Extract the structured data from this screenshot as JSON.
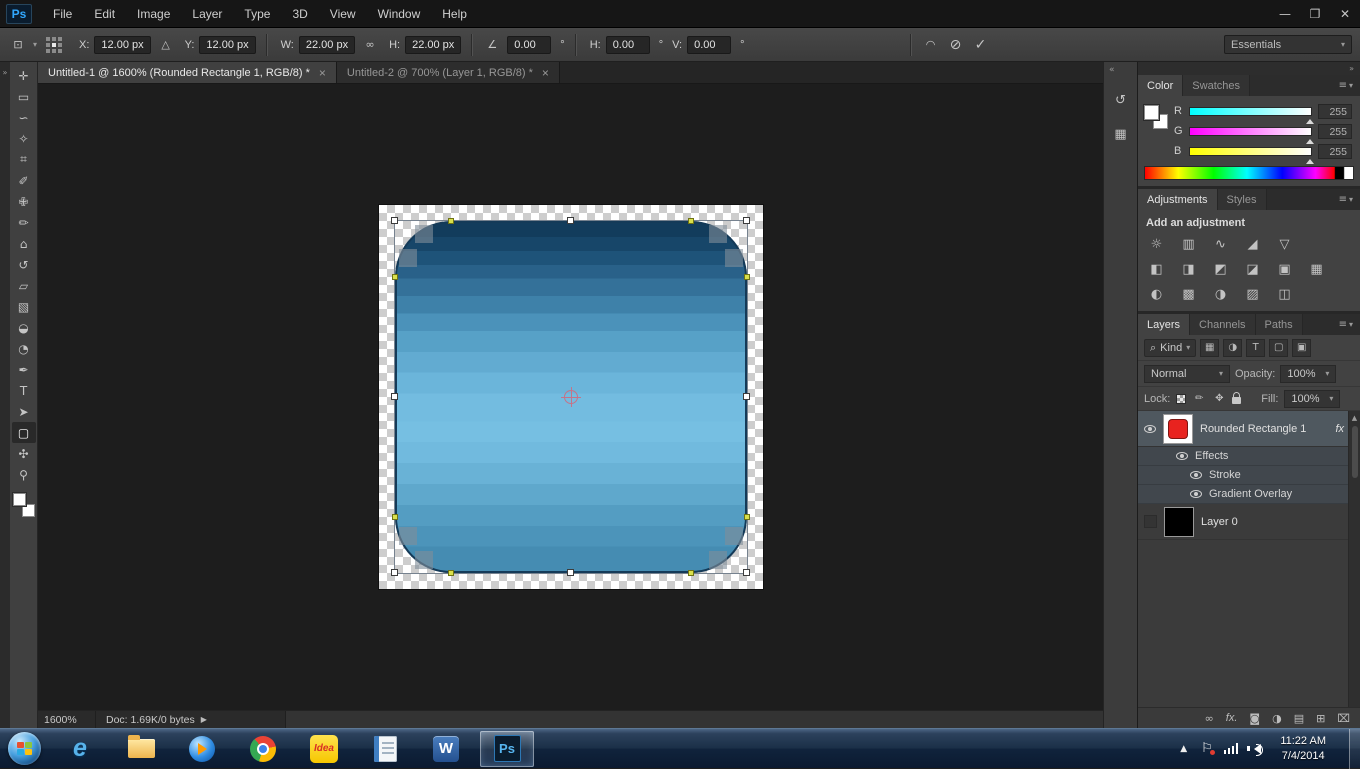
{
  "colors": {
    "ps-blue": "#31a8ff",
    "ps-logo-bg": "#0a1c2e",
    "thumb-red": "#e8231f",
    "layer-selected": "#4f585f",
    "taskbar-mid": "#1b3048"
  },
  "ui": {
    "caret_down": "▾",
    "collapse_right": "»",
    "scroll_up": "▲"
  },
  "titlebar": {
    "logo": "Ps",
    "menus": [
      "File",
      "Edit",
      "Image",
      "Layer",
      "Type",
      "3D",
      "View",
      "Window",
      "Help"
    ],
    "controls": {
      "minimize": "—",
      "maximize": "❐",
      "close": "✕"
    }
  },
  "options_bar": {
    "tool_icon": "⊡",
    "fields": {
      "x_label": "X:",
      "x_value": "12.00 px",
      "delta_icon": "△",
      "y_label": "Y:",
      "y_value": "12.00 px",
      "w_label": "W:",
      "w_value": "22.00 px",
      "link_icon": "∞",
      "h_label": "H:",
      "h_value": "22.00 px",
      "angle_icon": "∠",
      "angle_value": "0.00",
      "angle_unit": "°",
      "hskew_label": "H:",
      "hskew_value": "0.00",
      "hskew_unit": "°",
      "vskew_label": "V:",
      "vskew_value": "0.00",
      "vskew_unit": "°"
    },
    "warp_icon": "◠",
    "cancel_icon": "⊘",
    "commit_icon": "✓",
    "workspace": "Essentials"
  },
  "toolbar": {
    "expand_icon": "»",
    "tools": [
      {
        "name": "move",
        "glyph": "✛"
      },
      {
        "name": "rectangular-marquee",
        "glyph": "▭"
      },
      {
        "name": "lasso",
        "glyph": "∽"
      },
      {
        "name": "quick-selection",
        "glyph": "✧"
      },
      {
        "name": "crop",
        "glyph": "⌗"
      },
      {
        "name": "eyedropper",
        "glyph": "✐"
      },
      {
        "name": "spot-healing-brush",
        "glyph": "✙"
      },
      {
        "name": "brush",
        "glyph": "✏"
      },
      {
        "name": "clone-stamp",
        "glyph": "⌂"
      },
      {
        "name": "history-brush",
        "glyph": "↺"
      },
      {
        "name": "eraser",
        "glyph": "▱"
      },
      {
        "name": "gradient",
        "glyph": "▧"
      },
      {
        "name": "blur",
        "glyph": "◒"
      },
      {
        "name": "dodge",
        "glyph": "◔"
      },
      {
        "name": "pen",
        "glyph": "✒"
      },
      {
        "name": "type",
        "glyph": "T"
      },
      {
        "name": "path-selection",
        "glyph": "➤"
      },
      {
        "name": "rounded-rectangle",
        "glyph": "▢"
      },
      {
        "name": "hand",
        "glyph": "✣"
      },
      {
        "name": "zoom",
        "glyph": "⚲"
      }
    ]
  },
  "document_tabs": [
    {
      "title": "Untitled-1 @ 1600% (Rounded Rectangle 1, RGB/8) *",
      "close": "×"
    },
    {
      "title": "Untitled-2 @ 700% (Layer 1, RGB/8) *",
      "close": "×"
    }
  ],
  "status_bar": {
    "zoom": "1600%",
    "doc_info": "Doc: 1.69K/0 bytes",
    "expand_icon": "▶"
  },
  "dock_strip": {
    "collapse_icon": "«",
    "history_icon": "↺",
    "properties_icon": "▦"
  },
  "color_panel": {
    "tabs": [
      "Color",
      "Swatches"
    ],
    "menu_icon": "≡",
    "channels": [
      {
        "label": "R",
        "value": "255"
      },
      {
        "label": "G",
        "value": "255"
      },
      {
        "label": "B",
        "value": "255"
      }
    ]
  },
  "adjustments_panel": {
    "tabs": [
      "Adjustments",
      "Styles"
    ],
    "menu_icon": "≡",
    "heading": "Add an adjustment",
    "rows": [
      [
        {
          "name": "brightness-contrast",
          "glyph": "☼"
        },
        {
          "name": "levels",
          "glyph": "▥"
        },
        {
          "name": "curves",
          "glyph": "∿"
        },
        {
          "name": "exposure",
          "glyph": "◢"
        },
        {
          "name": "vibrance",
          "glyph": "▽"
        }
      ],
      [
        {
          "name": "hue-saturation",
          "glyph": "◧"
        },
        {
          "name": "color-balance",
          "glyph": "◨"
        },
        {
          "name": "black-white",
          "glyph": "◩"
        },
        {
          "name": "photo-filter",
          "glyph": "◪"
        },
        {
          "name": "channel-mixer",
          "glyph": "▣"
        },
        {
          "name": "color-lookup",
          "glyph": "▦"
        }
      ],
      [
        {
          "name": "invert",
          "glyph": "◐"
        },
        {
          "name": "posterize",
          "glyph": "▩"
        },
        {
          "name": "threshold",
          "glyph": "◑"
        },
        {
          "name": "gradient-map",
          "glyph": "▨"
        },
        {
          "name": "selective-color",
          "glyph": "◫"
        }
      ]
    ]
  },
  "layers_panel": {
    "tabs": [
      "Layers",
      "Channels",
      "Paths"
    ],
    "menu_icon": "≡",
    "filter": {
      "search_icon": "⌕",
      "label": "Kind",
      "icons": [
        {
          "name": "filter-pixel-layers",
          "glyph": "▦"
        },
        {
          "name": "filter-adjustment-layers",
          "glyph": "◑"
        },
        {
          "name": "filter-type-layers",
          "glyph": "T"
        },
        {
          "name": "filter-shape-layers",
          "glyph": "▢"
        },
        {
          "name": "filter-smart-objects",
          "glyph": "▣"
        }
      ]
    },
    "blend_mode": "Normal",
    "opacity_label": "Opacity:",
    "opacity_value": "100%",
    "lock_label": "Lock:",
    "lock_icons": [
      {
        "name": "lock-image-pixels",
        "glyph": "✏"
      },
      {
        "name": "lock-position",
        "glyph": "✥"
      }
    ],
    "fill_label": "Fill:",
    "fill_value": "100%",
    "layers": {
      "shape_layer": "Rounded Rectangle 1",
      "fx_badge": "fx",
      "effects": "Effects",
      "stroke": "Stroke",
      "gradient_overlay": "Gradient Overlay",
      "background_layer": "Layer 0"
    },
    "footer_icons": [
      {
        "name": "link-layers",
        "glyph": "∞"
      },
      {
        "name": "layer-style",
        "glyph": "fx."
      },
      {
        "name": "add-layer-mask",
        "glyph": "◙"
      },
      {
        "name": "new-adjustment-layer",
        "glyph": "◑"
      },
      {
        "name": "new-group",
        "glyph": "▤"
      },
      {
        "name": "new-layer",
        "glyph": "⊞"
      },
      {
        "name": "delete-layer",
        "glyph": "⌧"
      }
    ]
  },
  "taskbar": {
    "tray_expand_icon": "▲",
    "clock_time": "11:22 AM",
    "clock_date": "7/4/2014",
    "apps": {
      "ie": "e",
      "idea": "Idea",
      "word": "W",
      "photoshop": "Ps"
    }
  }
}
